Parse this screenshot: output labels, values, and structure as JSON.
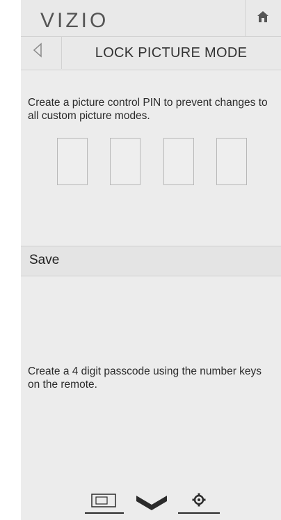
{
  "header": {
    "logo_text": "VIZIO",
    "title": "LOCK PICTURE MODE"
  },
  "icons": {
    "home": "home-icon",
    "back": "back-arrow-icon",
    "picture": "picture-icon",
    "collapse": "chevron-down-icon",
    "settings": "gear-icon"
  },
  "main": {
    "description": "Create a picture control PIN to prevent changes to all custom picture modes.",
    "pin_digits": [
      "",
      "",
      "",
      ""
    ],
    "save_label": "Save",
    "hint": "Create a 4 digit passcode using the number keys on the remote."
  },
  "colors": {
    "background": "#ececec",
    "text": "#2a2a2a",
    "border": "#b8b8b8"
  }
}
